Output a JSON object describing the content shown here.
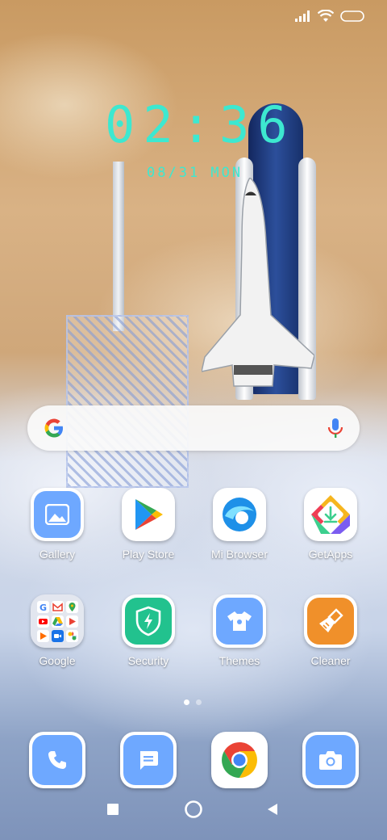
{
  "status_bar": {
    "signal_icon": "signal-icon",
    "wifi_icon": "wifi-icon",
    "battery_icon": "battery-icon"
  },
  "lockscreen_widget": {
    "time": "02:36",
    "date": "08/31 MON"
  },
  "search_bar": {
    "logo_icon": "google-g-icon",
    "mic_icon": "mic-icon"
  },
  "apps": [
    {
      "label": "Gallery",
      "icon": "gallery-icon",
      "color": "#6ea8ff"
    },
    {
      "label": "Play Store",
      "icon": "play-store-icon",
      "color": "#ffffff"
    },
    {
      "label": "Mi Browser",
      "icon": "mi-browser-icon",
      "color": "#ffffff"
    },
    {
      "label": "GetApps",
      "icon": "getapps-icon",
      "color": "#ffffff"
    },
    {
      "label": "Google",
      "icon": "google-folder-icon",
      "color": "#dfe3ea"
    },
    {
      "label": "Security",
      "icon": "security-shield-icon",
      "color": "#22c28e"
    },
    {
      "label": "Themes",
      "icon": "themes-shirt-icon",
      "color": "#6ea8ff"
    },
    {
      "label": "Cleaner",
      "icon": "cleaner-broom-icon",
      "color": "#f0902a"
    }
  ],
  "page_indicator": {
    "total": 2,
    "active": 1
  },
  "dock": [
    {
      "name": "phone",
      "icon": "phone-icon",
      "color": "#6ea8ff"
    },
    {
      "name": "messages",
      "icon": "message-icon",
      "color": "#6ea8ff"
    },
    {
      "name": "chrome",
      "icon": "chrome-icon",
      "color": "#ffffff"
    },
    {
      "name": "camera",
      "icon": "camera-icon",
      "color": "#6ea8ff"
    }
  ],
  "navbar": {
    "recents_icon": "recents-square-icon",
    "home_icon": "home-circle-icon",
    "back_icon": "back-triangle-icon"
  }
}
